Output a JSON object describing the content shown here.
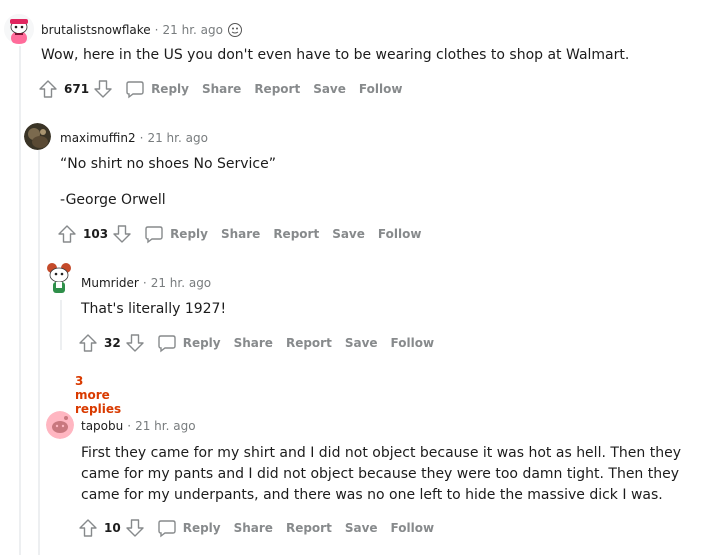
{
  "comments": [
    {
      "author": "brutalistsnowflake",
      "time": "21 hr. ago",
      "body": [
        "Wow, here in the US you don't even have to be wearing clothes to shop at Walmart."
      ],
      "score": "671",
      "avatar_icon": "snoo-avatar-icon"
    },
    {
      "author": "maximuffin2",
      "time": "21 hr. ago",
      "body": [
        "“No shirt no shoes No Service”",
        "-George Orwell"
      ],
      "score": "103",
      "avatar_icon": "user-photo-avatar"
    },
    {
      "author": "Mumrider",
      "time": "21 hr. ago",
      "body": [
        "That's literally 1927!"
      ],
      "score": "32",
      "avatar_icon": "snoo-avatar-icon"
    },
    {
      "author": "tapobu",
      "time": "21 hr. ago",
      "body": [
        "First they came for my shirt and I did not object because it was hot as hell. Then they came for my pants and I did not object because they were too damn tight. Then they came for my underpants, and there was no one left to hide the massive dick I was."
      ],
      "score": "10",
      "avatar_icon": "default-snoo-avatar-icon"
    }
  ],
  "actions": {
    "reply": "Reply",
    "share": "Share",
    "report": "Report",
    "save": "Save",
    "follow": "Follow"
  },
  "more_replies": "3 more replies",
  "colors": {
    "text": "#1c1c1c",
    "meta": "#787c7e",
    "action": "#878a8c",
    "more": "#d93a00",
    "thread": "#edeff1"
  }
}
